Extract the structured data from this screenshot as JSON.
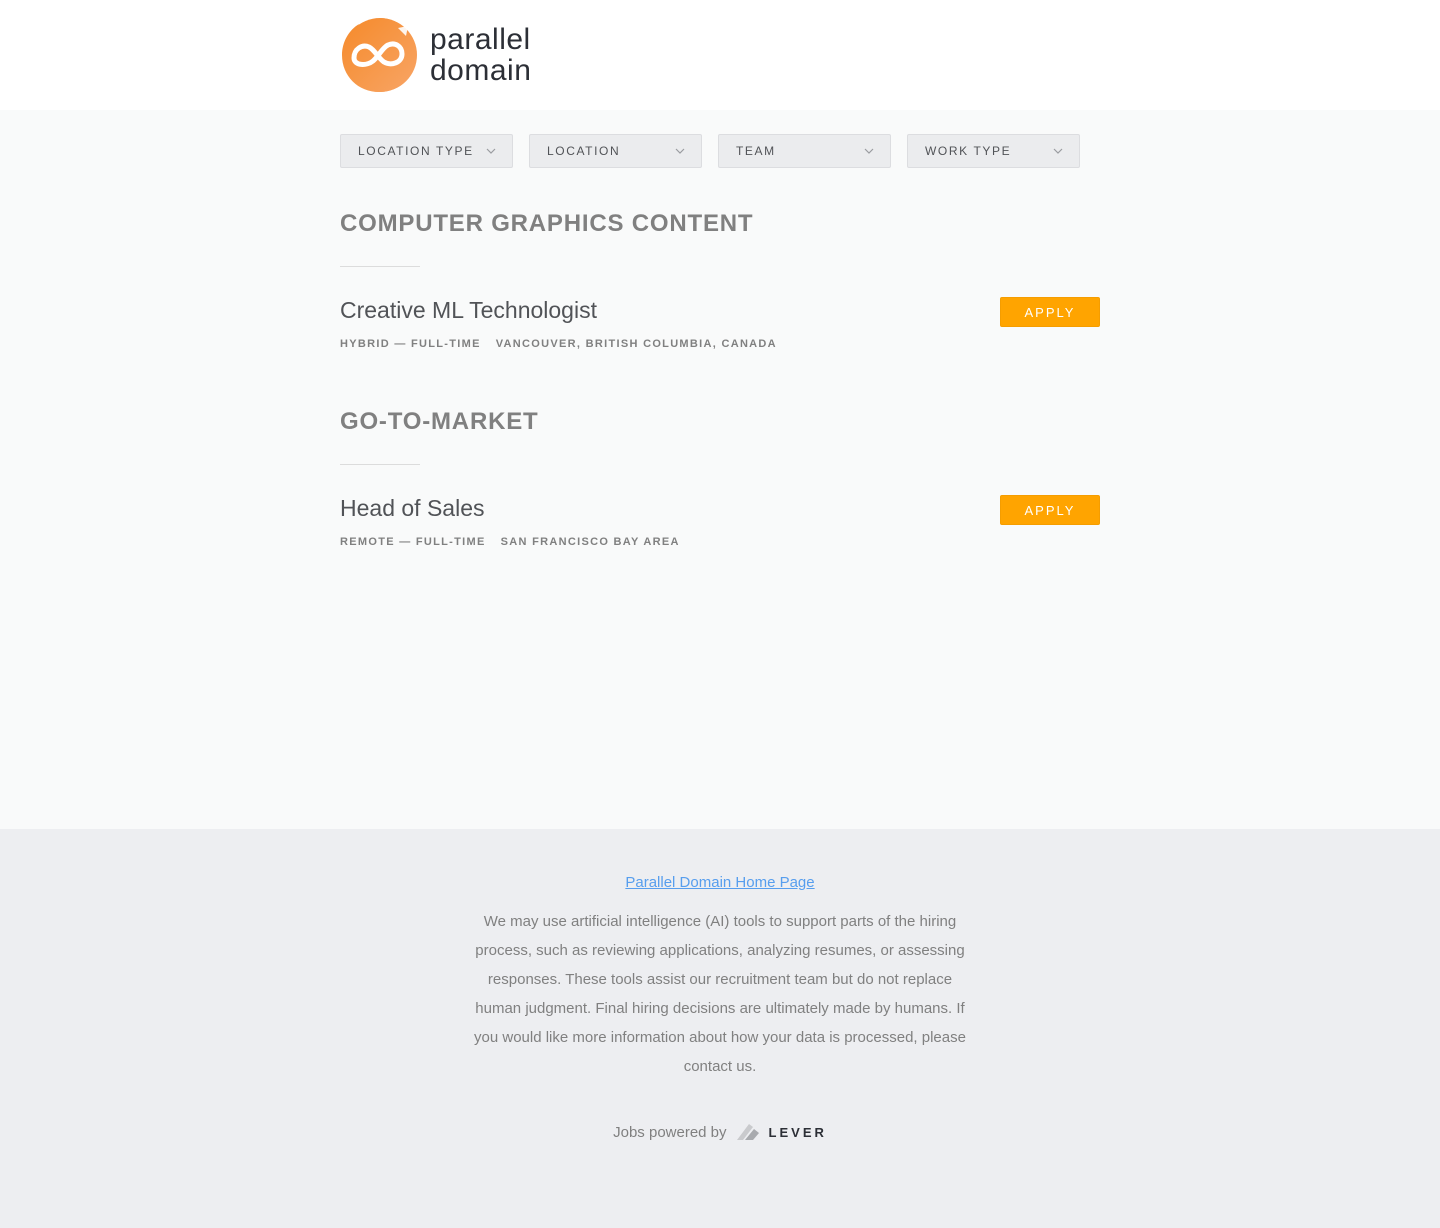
{
  "brand": {
    "name_line1": "parallel",
    "name_line2": "domain",
    "accent": "#f7882f"
  },
  "filters": [
    {
      "label": "LOCATION TYPE"
    },
    {
      "label": "LOCATION"
    },
    {
      "label": "TEAM"
    },
    {
      "label": "WORK TYPE"
    }
  ],
  "groups": [
    {
      "title": "COMPUTER GRAPHICS CONTENT",
      "postings": [
        {
          "title": "Creative ML Technologist",
          "commitment": "HYBRID — FULL-TIME",
          "location": "VANCOUVER, BRITISH COLUMBIA, CANADA",
          "apply_label": "APPLY"
        }
      ]
    },
    {
      "title": "GO-TO-MARKET",
      "postings": [
        {
          "title": "Head of Sales",
          "commitment": "REMOTE — FULL-TIME",
          "location": "SAN FRANCISCO BAY AREA",
          "apply_label": "APPLY"
        }
      ]
    }
  ],
  "footer": {
    "home_link": "Parallel Domain Home Page",
    "disclaimer": "We may use artificial intelligence (AI) tools to support parts of the hiring process, such as reviewing applications, analyzing resumes, or assessing responses. These tools assist our recruitment team but do not replace human judgment. Final hiring decisions are ultimately made by humans. If you would like more information about how your data is processed, please contact us.",
    "powered_by": "Jobs powered by",
    "lever_wordmark": "LEVER"
  },
  "colors": {
    "apply_button": "#ffa400",
    "link": "#579eee"
  }
}
